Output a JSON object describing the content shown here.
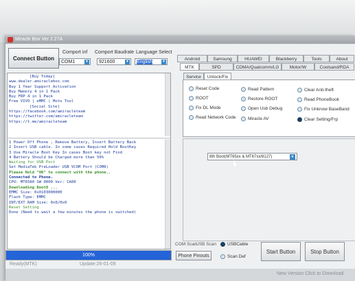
{
  "window": {
    "title": "Miracle Box Ver 2.27A"
  },
  "toolbar": {
    "connect_label": "Connect Button",
    "comport_label": "Comport inf",
    "comport_value": "COM1",
    "baud_label": "Comport Baudrate",
    "baud_value": "921600",
    "language_label": "Language Select",
    "language_value": "English"
  },
  "tabs_row1": [
    "Android",
    "Samsung",
    "HUAWEI",
    "Blackberry",
    "Tools",
    "About"
  ],
  "tabs_row2": [
    "MTK",
    "SPD",
    "CDMA/Qualcomm/LG",
    "Motor/W",
    "Coolsand/RDA"
  ],
  "tabs_row3": [
    "Service",
    "Unlock/Fix"
  ],
  "options": [
    {
      "label": "Reset Code",
      "selected": false
    },
    {
      "label": "Read Pattern",
      "selected": false
    },
    {
      "label": "Clear Anti-theft",
      "selected": false
    },
    {
      "label": "ROOT",
      "selected": false
    },
    {
      "label": "Restore ROOT",
      "selected": false
    },
    {
      "label": "Read PhoneBook",
      "selected": false
    },
    {
      "label": "Fix DL Mode",
      "selected": false
    },
    {
      "label": "Open Usb Debug",
      "selected": false
    },
    {
      "label": "Fix Unknow BaseBand",
      "selected": false
    },
    {
      "label": "Read Network Code",
      "selected": false
    },
    {
      "label": "Miracle AV",
      "selected": false
    },
    {
      "label": "Clear Setting/Frp",
      "selected": true
    }
  ],
  "model_select": {
    "value": "8th Boot(MT65xx & MT67xx/8127)"
  },
  "log": {
    "info_lines": [
      "[Buy Today]",
      "www.dealer.amiraclebox.com",
      "Buy 1 Year Support Activation",
      "Buy Memory 4 in 1 Pack",
      "Buy FRP 4 in 1 Pack",
      "Free VIVO | eMMC | Moto Tool",
      "[Social Site]",
      "https://facebook.com/amiracleteam",
      "https://twitter.com/amiracleteam",
      "https://t.me/amiracleteam"
    ],
    "steps": [
      "1  Power Off Phone , Remove Battery, Insert Battery Back",
      "2  Insert USB cable. In some cases Required Hold BootKey",
      "3  Use Miracle Boot Key In cases Boot key not Find",
      "4  Battery Should be Charged more than 50%",
      "Waiting for USB Port",
      "Set MediaTek PreLoader USB VCOM Port (COM8)",
      "Please Hold \"OK\" to connect with the phone..",
      "Connected to Phone.",
      "CPU: MT6580 SW 0000 Ver: CA00",
      "Downloading Boot8 ...",
      "EMMC Size: 0x0103000000",
      "Flash Type: EMMC",
      "INT/EXT RAM Size: 0x0/0x0",
      "Reset Setting",
      "Done (Need to wait a few minutes the phone is switched)"
    ]
  },
  "progress": {
    "percent": 1.0,
    "label": "100%"
  },
  "status": {
    "left": "Ready(MTK)",
    "update": "Update:26-01-09",
    "version_link": "New Version Click to Download"
  },
  "bottom": {
    "com_scan": "COM Scan",
    "usb_scan": "USB Scan",
    "usb_cable": "USBCable",
    "phone_pinouts": "Phone Pinouts",
    "scan_def": "Scan Def",
    "start": "Start Button",
    "stop": "Stop Button"
  },
  "colors": {
    "accent": "#2463d8",
    "selected_language_bg": "#2f6fd0",
    "log_green": "#3a8f2a",
    "log_blue": "#1a3a9a"
  }
}
